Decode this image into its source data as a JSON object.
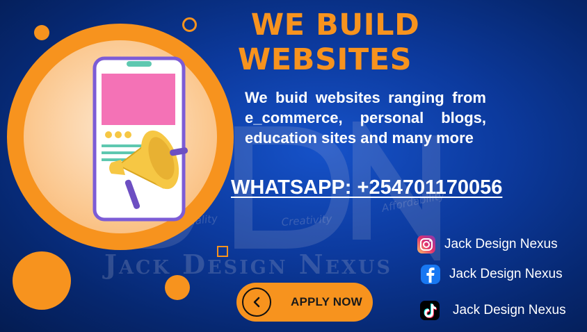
{
  "headline": {
    "line1": "WE BUILD",
    "line2": "WEBSITES"
  },
  "description": "We buid websites ranging from e_commerce, personal blogs, education sites and many more",
  "whatsapp": "WHATSAPP: +254701170056",
  "watermark": {
    "brand": "Jack Design Nexus",
    "tagline_words": [
      "Quality",
      "Creativity",
      "Affordability"
    ]
  },
  "apply_button": {
    "label": "APPLY NOW",
    "icon": "chevron-left-icon"
  },
  "socials": [
    {
      "platform": "instagram",
      "icon": "instagram-icon",
      "label": "Jack Design Nexus"
    },
    {
      "platform": "facebook",
      "icon": "facebook-icon",
      "label": "Jack Design Nexus"
    },
    {
      "platform": "tiktok",
      "icon": "tiktok-icon",
      "label": "Jack Design Nexus"
    }
  ],
  "colors": {
    "accent": "#f7931e",
    "background": "#0c3a9e",
    "text": "#ffffff",
    "phone_screen_header": "#f472b6",
    "phone_frame": "#7c5cd6",
    "phone_lines": "#5ec8b0",
    "megaphone": "#f6c744"
  },
  "illustration": {
    "icon": "phone-megaphone-illustration"
  }
}
